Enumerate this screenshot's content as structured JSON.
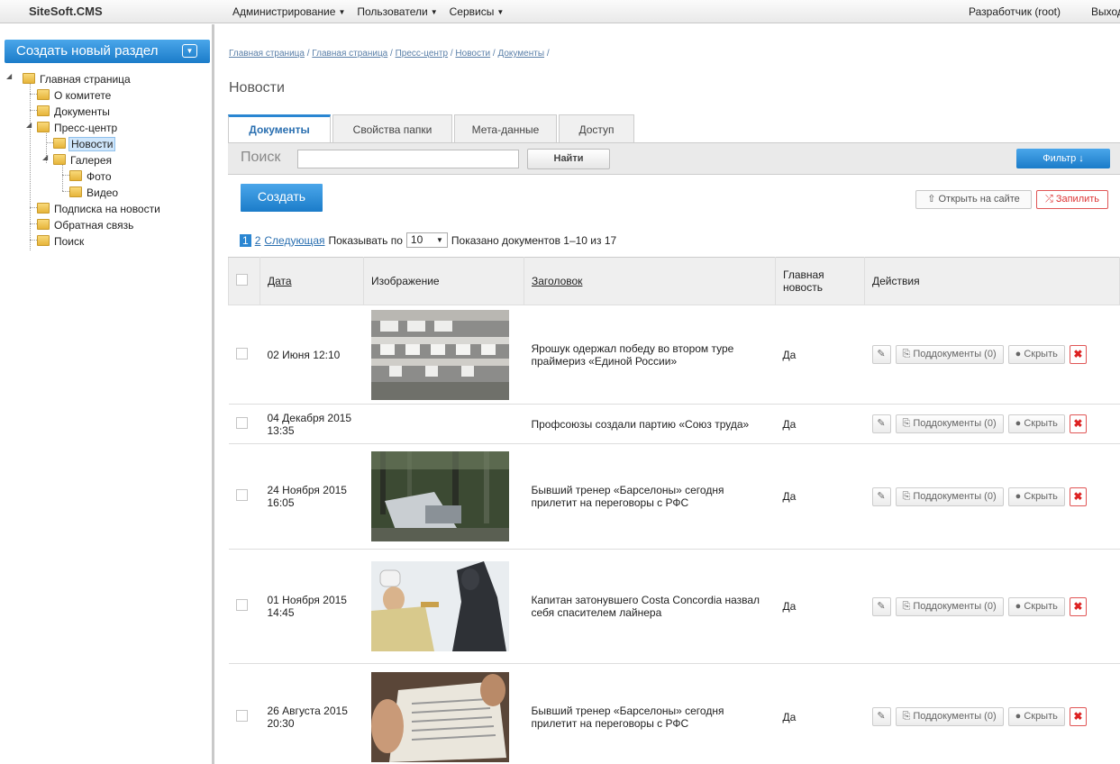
{
  "topbar": {
    "brand": "SiteSoft.CMS",
    "menu": [
      {
        "label": "Администрирование"
      },
      {
        "label": "Пользователи"
      },
      {
        "label": "Сервисы"
      }
    ],
    "user": "Разработчик (root)",
    "logout": "Выход"
  },
  "sidebar": {
    "new_section": "Создать новый раздел",
    "tree": [
      {
        "label": "Главная страница"
      },
      {
        "label": "О комитете"
      },
      {
        "label": "Документы"
      },
      {
        "label": "Пресс-центр"
      },
      {
        "label": "Новости"
      },
      {
        "label": "Галерея"
      },
      {
        "label": "Фото"
      },
      {
        "label": "Видео"
      },
      {
        "label": "Подписка на новости"
      },
      {
        "label": "Обратная связь"
      },
      {
        "label": "Поиск"
      }
    ]
  },
  "breadcrumb": [
    "Главная страница",
    "Главная страница",
    "Пресс-центр",
    "Новости",
    "Документы"
  ],
  "page_title": "Новости",
  "tabs": [
    {
      "label": "Документы",
      "active": true
    },
    {
      "label": "Свойства папки"
    },
    {
      "label": "Мета-данные"
    },
    {
      "label": "Доступ"
    }
  ],
  "search": {
    "label": "Поиск",
    "value": "",
    "button": "Найти"
  },
  "filter_label": "Фильтр ↓",
  "create_label": "Создать",
  "open_site_label": "Открыть на сайте",
  "pin_label": "Запилить",
  "pager": {
    "current": "1",
    "next_page": "2",
    "next_label": "Следующая",
    "per_page_label": "Показывать по",
    "per_page_value": "10",
    "summary": "Показано документов 1–10 из 17"
  },
  "table": {
    "headers": {
      "date": "Дата",
      "image": "Изображение",
      "title": "Заголовок",
      "main": "Главная новость",
      "actions": "Действия"
    },
    "subdocs_label": "Поддокументы (0)",
    "hide_label": "Скрыть",
    "rows": [
      {
        "date": "02 Июня 12:10",
        "title": "Ярошук одержал победу во втором туре праймериз «Единой России»",
        "main": "Да",
        "image": "building"
      },
      {
        "date": "04 Декабря 2015 13:35",
        "title": "Профсоюзы создали партию «Союз труда»",
        "main": "Да",
        "image": ""
      },
      {
        "date": "24 Ноября 2015 16:05",
        "title": "Бывший тренер «Барселоны» сегодня прилетит на переговоры с РФС",
        "main": "Да",
        "image": "forest"
      },
      {
        "date": "01 Ноября 2015 14:45",
        "title": "Капитан затонувшего Costa Concordia назвал себя спасителем лайнера",
        "main": "Да",
        "image": "priest"
      },
      {
        "date": "26 Августа 2015 20:30",
        "title": "Бывший тренер «Барселоны» сегодня прилетит на переговоры с РФС",
        "main": "Да",
        "image": "document"
      }
    ]
  }
}
